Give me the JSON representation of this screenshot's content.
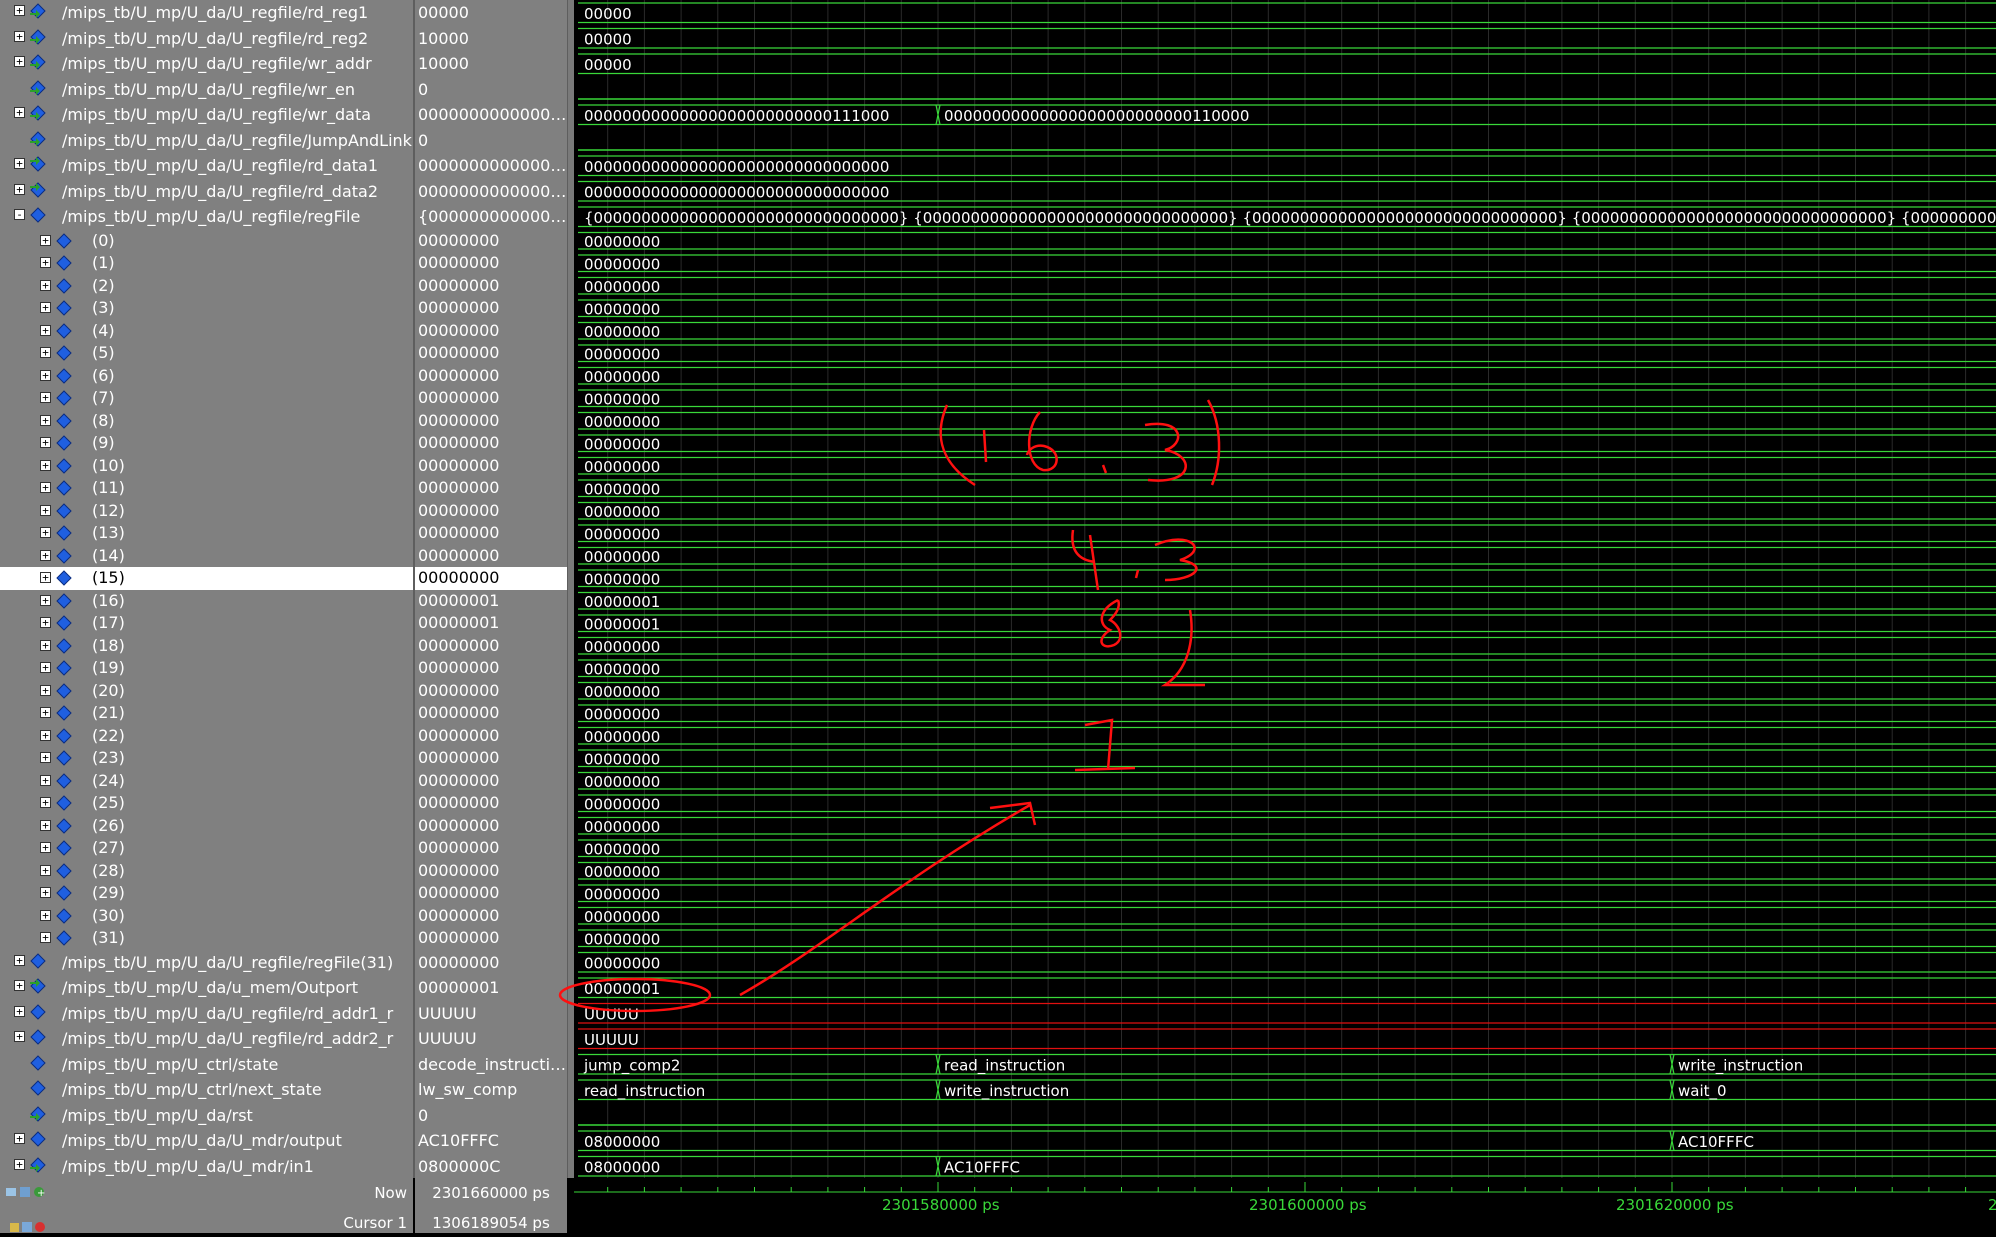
{
  "signals": [
    {
      "name": "/mips_tb/U_mp/U_da/U_regfile/rd_reg1",
      "value": "00000",
      "expand": "+",
      "icon": "in",
      "indent": 0,
      "segments": [
        {
          "v": "00000"
        }
      ]
    },
    {
      "name": "/mips_tb/U_mp/U_da/U_regfile/rd_reg2",
      "value": "10000",
      "expand": "+",
      "icon": "in",
      "indent": 0,
      "segments": [
        {
          "v": "00000"
        }
      ]
    },
    {
      "name": "/mips_tb/U_mp/U_da/U_regfile/wr_addr",
      "value": "10000",
      "expand": "+",
      "icon": "in",
      "indent": 0,
      "segments": [
        {
          "v": "00000"
        }
      ]
    },
    {
      "name": "/mips_tb/U_mp/U_da/U_regfile/wr_en",
      "value": "0",
      "expand": "",
      "icon": "in",
      "indent": 0,
      "kind": "bit",
      "segments": []
    },
    {
      "name": "/mips_tb/U_mp/U_da/U_regfile/wr_data",
      "value": "00000000000000...",
      "expand": "+",
      "icon": "in",
      "indent": 0,
      "segments": [
        {
          "v": "00000000000000000000000000111000"
        },
        {
          "v": "00000000000000000000000000110000",
          "at": 1580
        }
      ]
    },
    {
      "name": "/mips_tb/U_mp/U_da/U_regfile/JumpAndLink",
      "value": "0",
      "expand": "",
      "icon": "in",
      "indent": 0,
      "kind": "bit",
      "segments": []
    },
    {
      "name": "/mips_tb/U_mp/U_da/U_regfile/rd_data1",
      "value": "00000000000000...",
      "expand": "+",
      "icon": "out",
      "indent": 0,
      "segments": [
        {
          "v": "00000000000000000000000000000000"
        }
      ]
    },
    {
      "name": "/mips_tb/U_mp/U_da/U_regfile/rd_data2",
      "value": "00000000000000...",
      "expand": "+",
      "icon": "out",
      "indent": 0,
      "segments": [
        {
          "v": "00000000000000000000000000000000"
        }
      ]
    },
    {
      "name": "/mips_tb/U_mp/U_da/U_regfile/regFile",
      "value": "{0000000000000...",
      "expand": "-",
      "icon": "sig",
      "indent": 0,
      "segments": [
        {
          "v": "{00000000000000000000000000000000} {00000000000000000000000000000000} {00000000000000000000000000000000} {00000000000000000000000000000000} {00000000000000000000000000000000}"
        }
      ]
    },
    {
      "name": "(0)",
      "value": "00000000",
      "expand": "+",
      "icon": "sig",
      "indent": 1,
      "segments": [
        {
          "v": "00000000"
        }
      ]
    },
    {
      "name": "(1)",
      "value": "00000000",
      "expand": "+",
      "icon": "sig",
      "indent": 1,
      "segments": [
        {
          "v": "00000000"
        }
      ]
    },
    {
      "name": "(2)",
      "value": "00000000",
      "expand": "+",
      "icon": "sig",
      "indent": 1,
      "segments": [
        {
          "v": "00000000"
        }
      ]
    },
    {
      "name": "(3)",
      "value": "00000000",
      "expand": "+",
      "icon": "sig",
      "indent": 1,
      "segments": [
        {
          "v": "00000000"
        }
      ]
    },
    {
      "name": "(4)",
      "value": "00000000",
      "expand": "+",
      "icon": "sig",
      "indent": 1,
      "segments": [
        {
          "v": "00000000"
        }
      ]
    },
    {
      "name": "(5)",
      "value": "00000000",
      "expand": "+",
      "icon": "sig",
      "indent": 1,
      "segments": [
        {
          "v": "00000000"
        }
      ]
    },
    {
      "name": "(6)",
      "value": "00000000",
      "expand": "+",
      "icon": "sig",
      "indent": 1,
      "segments": [
        {
          "v": "00000000"
        }
      ]
    },
    {
      "name": "(7)",
      "value": "00000000",
      "expand": "+",
      "icon": "sig",
      "indent": 1,
      "segments": [
        {
          "v": "00000000"
        }
      ]
    },
    {
      "name": "(8)",
      "value": "00000000",
      "expand": "+",
      "icon": "sig",
      "indent": 1,
      "segments": [
        {
          "v": "00000000"
        }
      ]
    },
    {
      "name": "(9)",
      "value": "00000000",
      "expand": "+",
      "icon": "sig",
      "indent": 1,
      "segments": [
        {
          "v": "00000000"
        }
      ]
    },
    {
      "name": "(10)",
      "value": "00000000",
      "expand": "+",
      "icon": "sig",
      "indent": 1,
      "segments": [
        {
          "v": "00000000"
        }
      ]
    },
    {
      "name": "(11)",
      "value": "00000000",
      "expand": "+",
      "icon": "sig",
      "indent": 1,
      "segments": [
        {
          "v": "00000000"
        }
      ]
    },
    {
      "name": "(12)",
      "value": "00000000",
      "expand": "+",
      "icon": "sig",
      "indent": 1,
      "segments": [
        {
          "v": "00000000"
        }
      ]
    },
    {
      "name": "(13)",
      "value": "00000000",
      "expand": "+",
      "icon": "sig",
      "indent": 1,
      "segments": [
        {
          "v": "00000000"
        }
      ]
    },
    {
      "name": "(14)",
      "value": "00000000",
      "expand": "+",
      "icon": "sig",
      "indent": 1,
      "segments": [
        {
          "v": "00000000"
        }
      ]
    },
    {
      "name": "(15)",
      "value": "00000000",
      "expand": "+",
      "icon": "sig",
      "indent": 1,
      "selected": true,
      "segments": [
        {
          "v": "00000000"
        }
      ]
    },
    {
      "name": "(16)",
      "value": "00000001",
      "expand": "+",
      "icon": "sig",
      "indent": 1,
      "segments": [
        {
          "v": "00000001"
        }
      ]
    },
    {
      "name": "(17)",
      "value": "00000001",
      "expand": "+",
      "icon": "sig",
      "indent": 1,
      "segments": [
        {
          "v": "00000001"
        }
      ]
    },
    {
      "name": "(18)",
      "value": "00000000",
      "expand": "+",
      "icon": "sig",
      "indent": 1,
      "segments": [
        {
          "v": "00000000"
        }
      ]
    },
    {
      "name": "(19)",
      "value": "00000000",
      "expand": "+",
      "icon": "sig",
      "indent": 1,
      "segments": [
        {
          "v": "00000000"
        }
      ]
    },
    {
      "name": "(20)",
      "value": "00000000",
      "expand": "+",
      "icon": "sig",
      "indent": 1,
      "segments": [
        {
          "v": "00000000"
        }
      ]
    },
    {
      "name": "(21)",
      "value": "00000000",
      "expand": "+",
      "icon": "sig",
      "indent": 1,
      "segments": [
        {
          "v": "00000000"
        }
      ]
    },
    {
      "name": "(22)",
      "value": "00000000",
      "expand": "+",
      "icon": "sig",
      "indent": 1,
      "segments": [
        {
          "v": "00000000"
        }
      ]
    },
    {
      "name": "(23)",
      "value": "00000000",
      "expand": "+",
      "icon": "sig",
      "indent": 1,
      "segments": [
        {
          "v": "00000000"
        }
      ]
    },
    {
      "name": "(24)",
      "value": "00000000",
      "expand": "+",
      "icon": "sig",
      "indent": 1,
      "segments": [
        {
          "v": "00000000"
        }
      ]
    },
    {
      "name": "(25)",
      "value": "00000000",
      "expand": "+",
      "icon": "sig",
      "indent": 1,
      "segments": [
        {
          "v": "00000000"
        }
      ]
    },
    {
      "name": "(26)",
      "value": "00000000",
      "expand": "+",
      "icon": "sig",
      "indent": 1,
      "segments": [
        {
          "v": "00000000"
        }
      ]
    },
    {
      "name": "(27)",
      "value": "00000000",
      "expand": "+",
      "icon": "sig",
      "indent": 1,
      "segments": [
        {
          "v": "00000000"
        }
      ]
    },
    {
      "name": "(28)",
      "value": "00000000",
      "expand": "+",
      "icon": "sig",
      "indent": 1,
      "segments": [
        {
          "v": "00000000"
        }
      ]
    },
    {
      "name": "(29)",
      "value": "00000000",
      "expand": "+",
      "icon": "sig",
      "indent": 1,
      "segments": [
        {
          "v": "00000000"
        }
      ]
    },
    {
      "name": "(30)",
      "value": "00000000",
      "expand": "+",
      "icon": "sig",
      "indent": 1,
      "segments": [
        {
          "v": "00000000"
        }
      ]
    },
    {
      "name": "(31)",
      "value": "00000000",
      "expand": "+",
      "icon": "sig",
      "indent": 1,
      "segments": [
        {
          "v": "00000000"
        }
      ]
    },
    {
      "name": "/mips_tb/U_mp/U_da/U_regfile/regFile(31)",
      "value": "00000000",
      "expand": "+",
      "icon": "sig",
      "indent": 0,
      "segments": [
        {
          "v": "00000000"
        }
      ]
    },
    {
      "name": "/mips_tb/U_mp/U_da/u_mem/Outport",
      "value": "00000001",
      "expand": "+",
      "icon": "out",
      "indent": 0,
      "segments": [
        {
          "v": "00000001"
        }
      ]
    },
    {
      "name": "/mips_tb/U_mp/U_da/U_regfile/rd_addr1_r",
      "value": "UUUUU",
      "expand": "+",
      "icon": "sig",
      "indent": 0,
      "kind": "undef",
      "segments": [
        {
          "v": "UUUUU"
        }
      ]
    },
    {
      "name": "/mips_tb/U_mp/U_da/U_regfile/rd_addr2_r",
      "value": "UUUUU",
      "expand": "+",
      "icon": "sig",
      "indent": 0,
      "kind": "undef",
      "segments": [
        {
          "v": "UUUUU"
        }
      ]
    },
    {
      "name": "/mips_tb/U_mp/U_ctrl/state",
      "value": "decode_instruction",
      "expand": "",
      "icon": "sig",
      "indent": 0,
      "segments": [
        {
          "v": "jump_comp2"
        },
        {
          "v": "read_instruction",
          "at": 1580
        },
        {
          "v": "write_instruction",
          "at": 1620
        }
      ]
    },
    {
      "name": "/mips_tb/U_mp/U_ctrl/next_state",
      "value": "lw_sw_comp",
      "expand": "",
      "icon": "sig",
      "indent": 0,
      "segments": [
        {
          "v": "read_instruction"
        },
        {
          "v": "write_instruction",
          "at": 1580
        },
        {
          "v": "wait_0",
          "at": 1620
        }
      ]
    },
    {
      "name": "/mips_tb/U_mp/U_da/rst",
      "value": "0",
      "expand": "",
      "icon": "in",
      "indent": 0,
      "kind": "bit",
      "segments": []
    },
    {
      "name": "/mips_tb/U_mp/U_da/U_mdr/output",
      "value": "AC10FFFC",
      "expand": "+",
      "icon": "sig",
      "indent": 0,
      "segments": [
        {
          "v": "08000000"
        },
        {
          "v": "AC10FFFC",
          "at": 1620
        }
      ]
    },
    {
      "name": "/mips_tb/U_mp/U_da/U_mdr/in1",
      "value": "0800000C",
      "expand": "+",
      "icon": "in",
      "indent": 0,
      "segments": [
        {
          "v": "08000000"
        },
        {
          "v": "AC10FFFC",
          "at": 1580
        }
      ]
    }
  ],
  "footer": {
    "now_label": "Now",
    "now_value": "2301660000 ps",
    "cursor_label": "Cursor 1",
    "cursor_value": "1306189054 ps"
  },
  "timeline": {
    "unit": "ps",
    "tick_labels": [
      "2301580000 ps",
      "2301600000 ps",
      "2301620000 ps",
      "2"
    ]
  },
  "colors": {
    "wave": "#39d839",
    "undefined": "#e01010",
    "annotation": "#ff1010",
    "panel": "#808080",
    "selected_row": "#ffffff"
  },
  "annotation": {
    "handwritten_notes": [
      "(16,3)",
      "4,3",
      "8,2",
      "1"
    ]
  }
}
